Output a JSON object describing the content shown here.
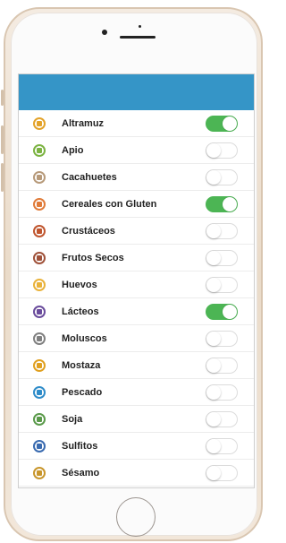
{
  "items": [
    {
      "label": "Altramuz",
      "enabled": true,
      "color": "#e3a32a"
    },
    {
      "label": "Apio",
      "enabled": false,
      "color": "#7cb342"
    },
    {
      "label": "Cacahuetes",
      "enabled": false,
      "color": "#b79a7a"
    },
    {
      "label": "Cereales con Gluten",
      "enabled": true,
      "color": "#e07b39"
    },
    {
      "label": "Crustáceos",
      "enabled": false,
      "color": "#c0562f"
    },
    {
      "label": "Frutos Secos",
      "enabled": false,
      "color": "#a0523a"
    },
    {
      "label": "Huevos",
      "enabled": false,
      "color": "#e9b23a"
    },
    {
      "label": "Lácteos",
      "enabled": true,
      "color": "#6a4c9c"
    },
    {
      "label": "Moluscos",
      "enabled": false,
      "color": "#808080"
    },
    {
      "label": "Mostaza",
      "enabled": false,
      "color": "#e0a020"
    },
    {
      "label": "Pescado",
      "enabled": false,
      "color": "#2f8cc9"
    },
    {
      "label": "Soja",
      "enabled": false,
      "color": "#5a9a4a"
    },
    {
      "label": "Sulfitos",
      "enabled": false,
      "color": "#3a6bb0"
    },
    {
      "label": "Sésamo",
      "enabled": false,
      "color": "#c8962c"
    }
  ]
}
